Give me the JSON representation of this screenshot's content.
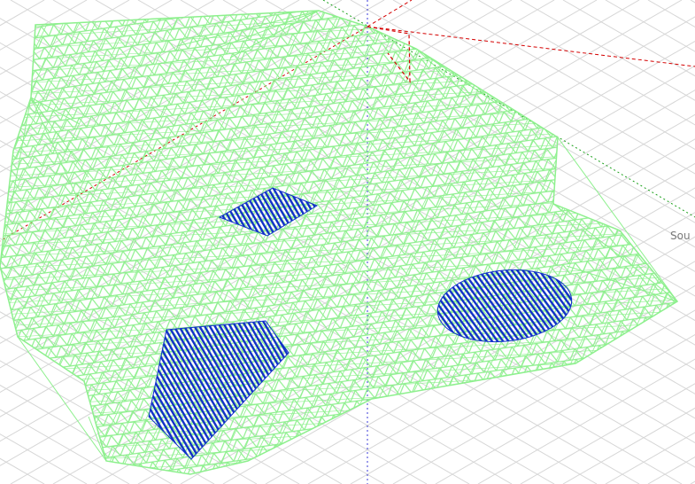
{
  "viewport": {
    "compass_label": "Sou",
    "colors": {
      "background": "#ffffff",
      "ground_grid": "#d6d6d6",
      "mesh": "#8ef08e",
      "region_fill": "#1030c8",
      "axis_x": "#d40000",
      "axis_y": "#1aa01a",
      "axis_z": "#3a3ad8"
    },
    "objects": [
      {
        "name": "terrain-mesh",
        "kind": "triangulated surface wireframe"
      },
      {
        "name": "region-square",
        "kind": "dense point region"
      },
      {
        "name": "region-ellipse",
        "kind": "dense point region"
      },
      {
        "name": "region-polygon",
        "kind": "dense point region"
      }
    ]
  }
}
